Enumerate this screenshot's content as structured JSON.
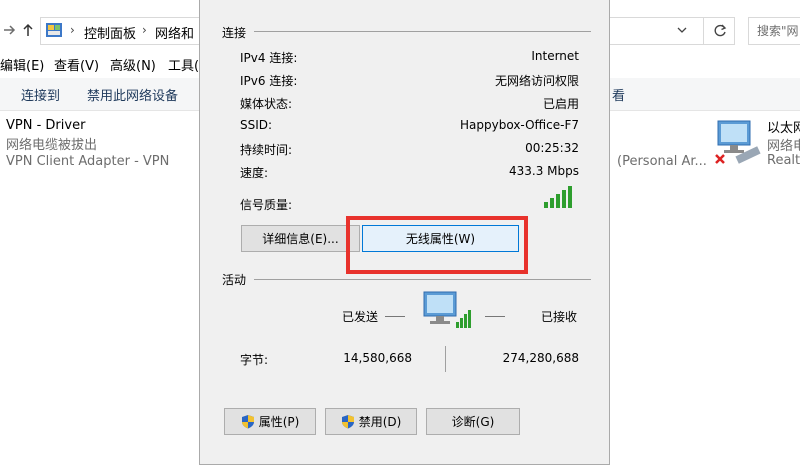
{
  "explorer": {
    "breadcrumb": [
      "控制面板",
      "网络和 I"
    ],
    "search_placeholder": "搜索\"网",
    "menu": [
      "编辑(E)",
      "查看(V)",
      "高级(N)",
      "工具("
    ],
    "commands": [
      "连接到",
      "禁用此网络设备",
      "看"
    ],
    "adapters": {
      "vpn": {
        "name": "VPN - Driver",
        "status": "网络电缆被拔出",
        "device": "VPN Client Adapter - VPN"
      },
      "hidden_device": "(Personal Ar...",
      "ethernet": {
        "name": "以太网",
        "status": "网络电缆",
        "device": "Realte"
      }
    }
  },
  "dialog": {
    "connection_title": "连接",
    "rows": [
      {
        "label": "IPv4 连接:",
        "value": "Internet"
      },
      {
        "label": "IPv6 连接:",
        "value": "无网络访问权限"
      },
      {
        "label": "媒体状态:",
        "value": "已启用"
      },
      {
        "label": "SSID:",
        "value": "Happybox-Office-F7"
      },
      {
        "label": "持续时间:",
        "value": "00:25:32"
      },
      {
        "label": "速度:",
        "value": "433.3 Mbps"
      }
    ],
    "signal_label": "信号质量:",
    "signal_bars": 5,
    "details_button": "详细信息(E)...",
    "wireless_props_button": "无线属性(W)",
    "activity_title": "活动",
    "sent_label": "已发送",
    "received_label": "已接收",
    "bytes_label": "字节:",
    "bytes_sent": "14,580,668",
    "bytes_received": "274,280,688",
    "properties_button": "属性(P)",
    "disable_button": "禁用(D)",
    "diagnose_button": "诊断(G)"
  },
  "colors": {
    "highlight": "#e8322c",
    "signal": "#2e9e2e",
    "accent": "#0078d7"
  }
}
